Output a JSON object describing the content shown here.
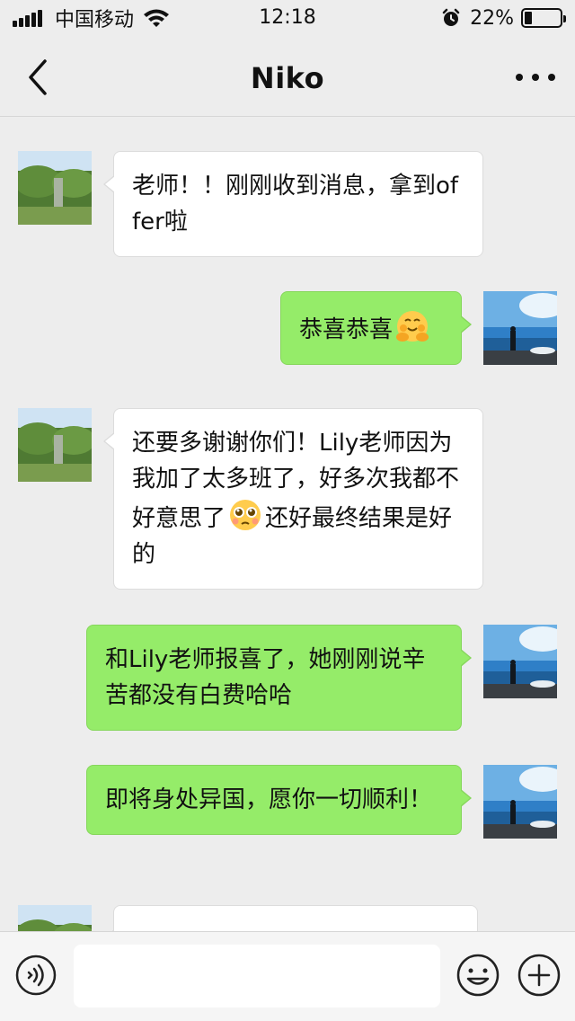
{
  "status_bar": {
    "carrier": "中国移动",
    "time": "12:18",
    "battery_percent_label": "22%",
    "battery_level": 0.22
  },
  "nav": {
    "title": "Niko"
  },
  "messages": [
    {
      "side": "incoming",
      "text": "老师！！刚刚收到消息，拿到offer啦"
    },
    {
      "side": "outgoing",
      "text_before": "恭喜恭喜",
      "emoji": "hugging-face-emoji"
    },
    {
      "side": "incoming",
      "text_before": "还要多谢谢你们！Lily老师因为我加了太多班了，好多次我都不好意思了",
      "emoji": "pleading-face-emoji",
      "text_after": "还好最终结果是好的"
    },
    {
      "side": "outgoing",
      "text": "和Lily老师报喜了，她刚刚说辛苦都没有白费哈哈"
    },
    {
      "side": "outgoing",
      "text": "即将身处异国，愿你一切顺利！"
    }
  ],
  "input": {
    "placeholder": ""
  },
  "colors": {
    "background": "#ededed",
    "incoming_bubble": "#ffffff",
    "outgoing_bubble": "#95ec69",
    "input_bar": "#f5f5f5"
  },
  "icons": [
    "signal-icon",
    "wifi-icon",
    "alarm-icon",
    "battery-icon",
    "back-arrow-icon",
    "more-icon",
    "voice-icon",
    "emoji-icon",
    "plus-icon"
  ]
}
